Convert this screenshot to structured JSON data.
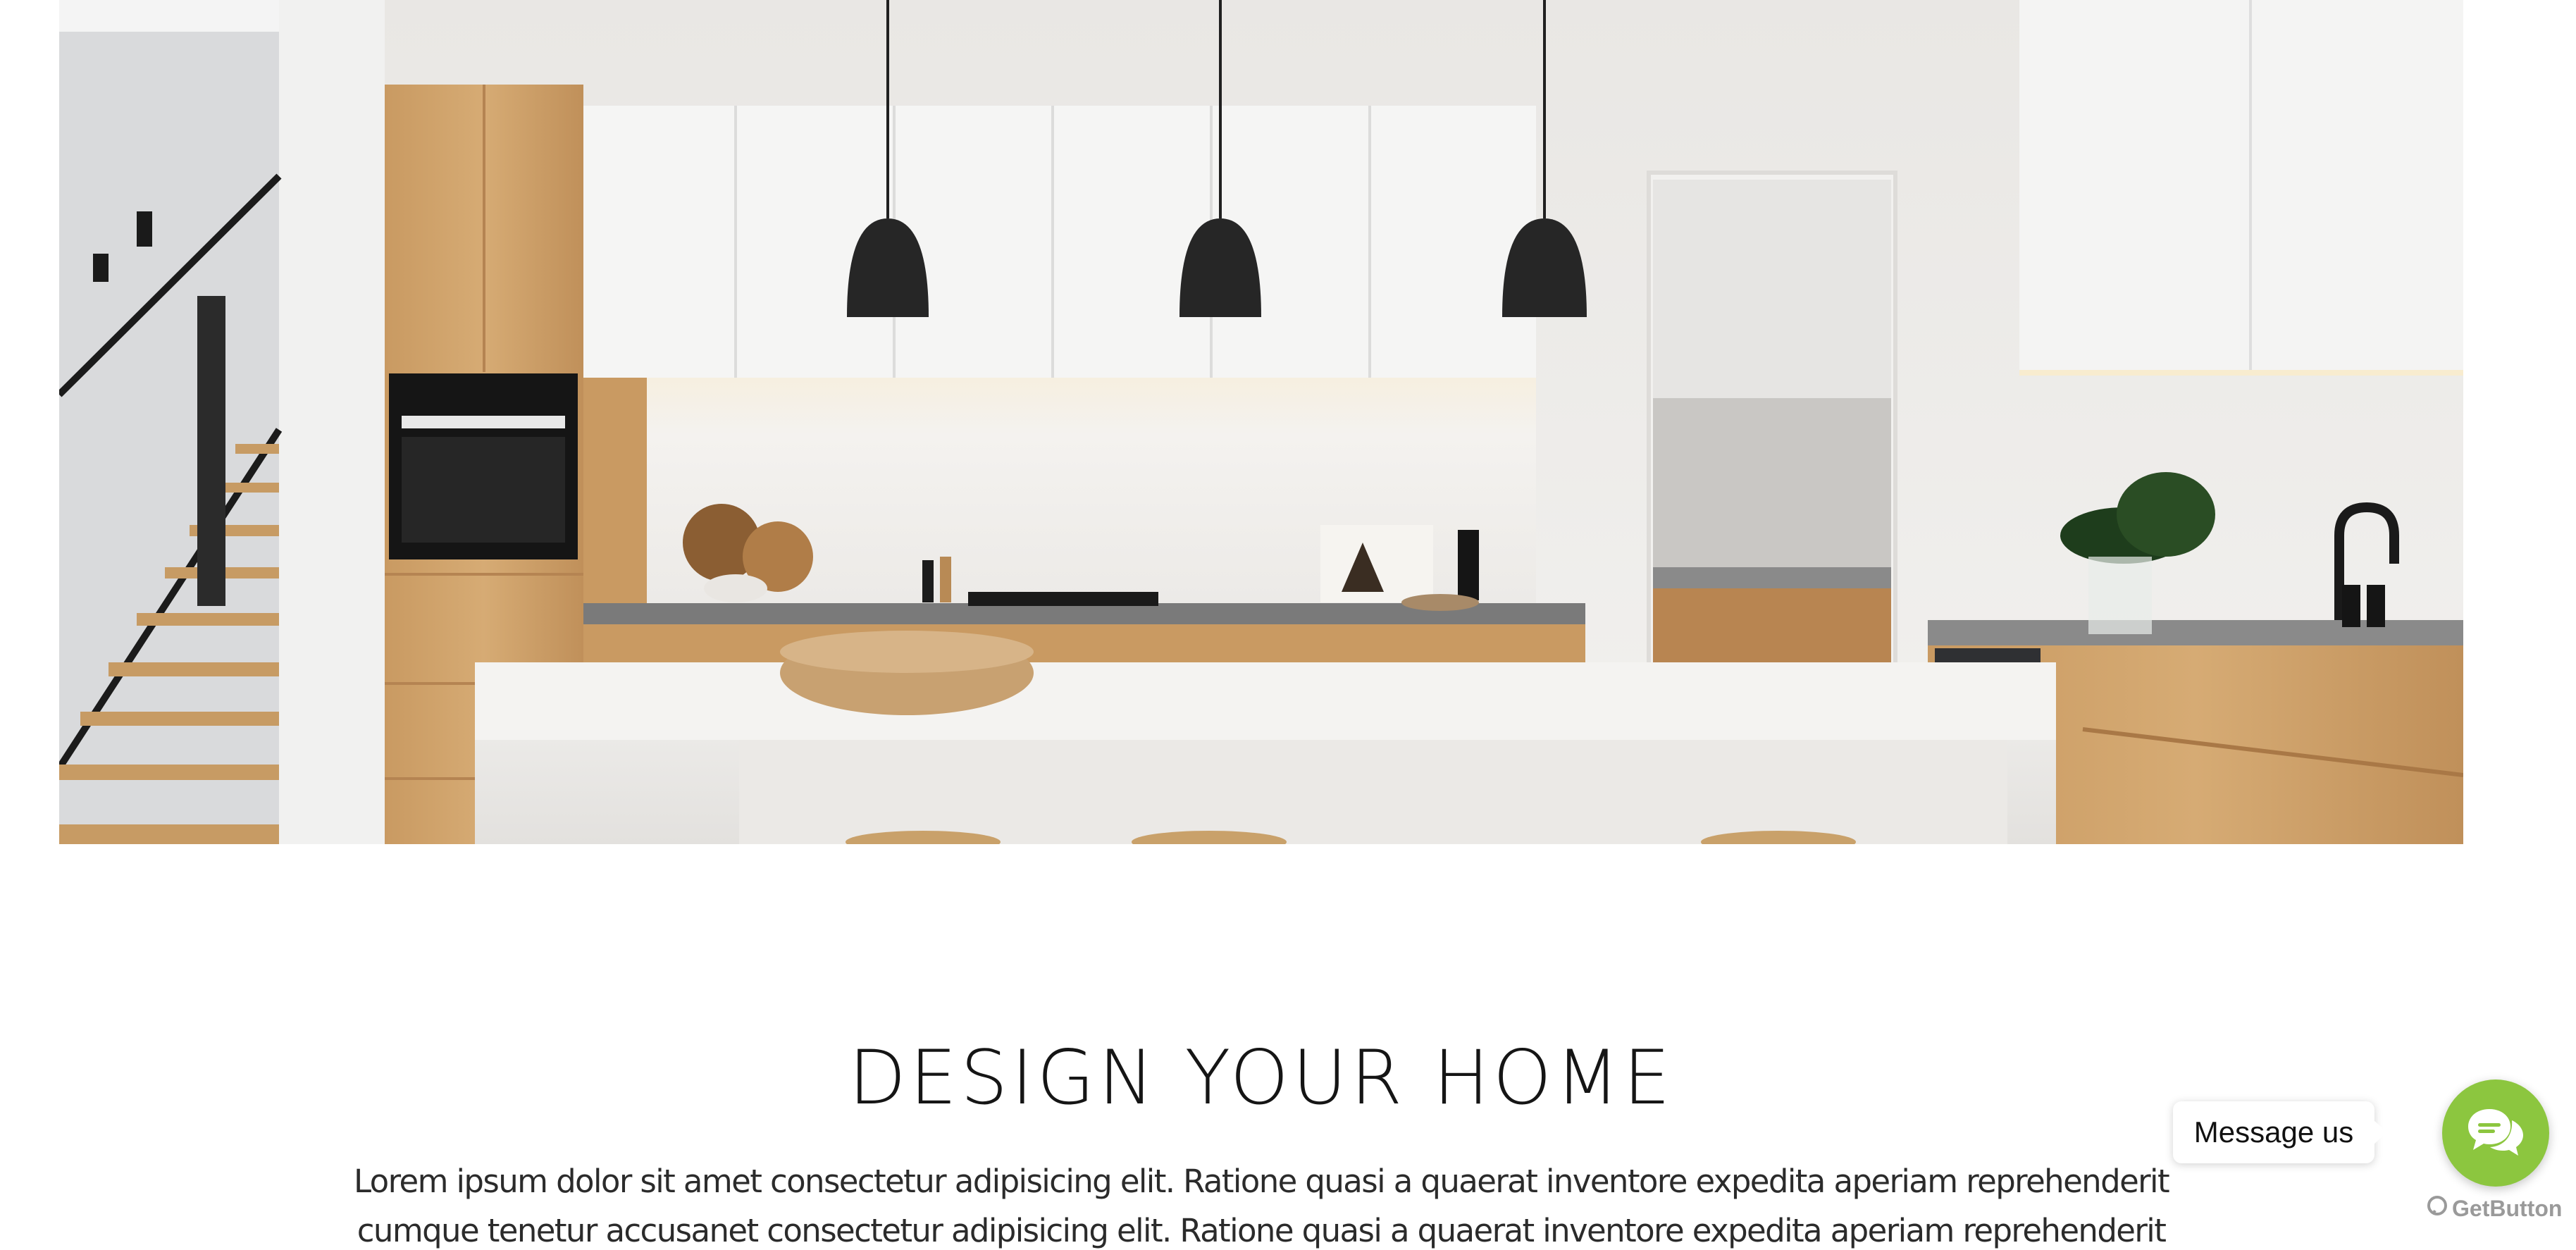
{
  "hero": {
    "image_subject": "modern kitchen interior"
  },
  "section": {
    "title": "DESIGN YOUR HOME",
    "body_line1": "Lorem ipsum dolor sit amet consectetur adipisicing elit. Ratione quasi a quaerat inventore expedita aperiam reprehenderit",
    "body_line2": "cumque tenetur accusanet consectetur adipisicing elit. Ratione quasi a quaerat inventore expedita aperiam reprehenderit"
  },
  "chat_widget": {
    "message_label": "Message us",
    "brand_label": "GetButton",
    "button_icon": "chat-bubbles-icon",
    "accent_color": "#8cc63f"
  }
}
